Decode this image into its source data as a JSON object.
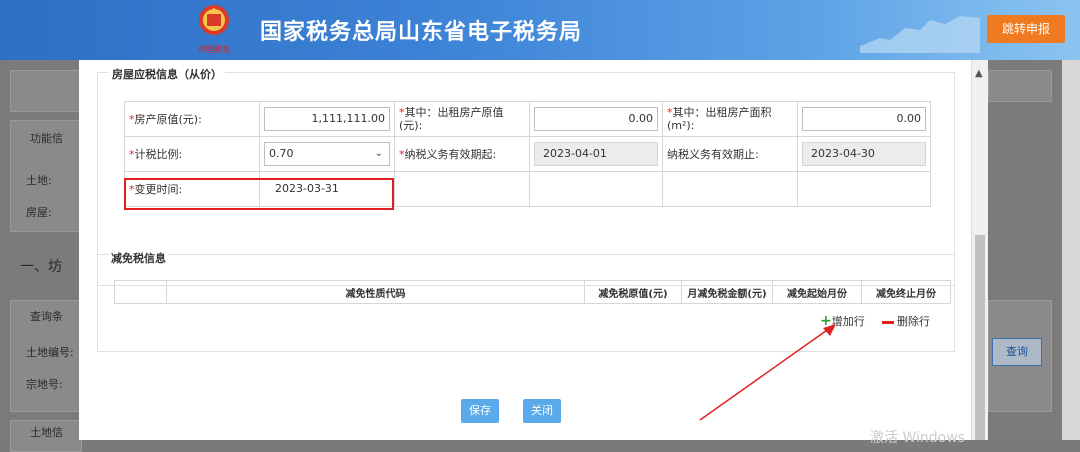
{
  "banner": {
    "title": "国家税务总局山东省电子税务局",
    "jump_button": "跳转申报",
    "emblem_text": "中国税务"
  },
  "background": {
    "labels": [
      "功能信",
      "土地:",
      "房屋:",
      "一、坊",
      "查询条",
      "土地编号:",
      "宗地号:",
      "土地信"
    ],
    "query_button": "查询"
  },
  "dialog": {
    "house_section": {
      "title": "房屋应税信息（从价）",
      "required_mark": "*",
      "fields": {
        "original_value_label": "房产原值(元):",
        "original_value": "1,111,111.00",
        "rented_original_value_label": "其中：出租房产原值(元):",
        "rented_original_value": "0.00",
        "rented_area_label": "其中：出租房产面积(m²):",
        "rented_area": "0.00",
        "tax_ratio_label": "计税比例:",
        "tax_ratio": "0.70",
        "obligation_start_label": "纳税义务有效期起:",
        "obligation_start": "2023-04-01",
        "obligation_end_label": "纳税义务有效期止:",
        "obligation_end": "2023-04-30",
        "change_time_label": "变更时间:",
        "change_time": "2023-03-31"
      }
    },
    "relief_section": {
      "title": "减免税信息",
      "columns": [
        "减免性质代码",
        "减免税原值(元)",
        "月减免税金额(元)",
        "减免起始月份",
        "减免终止月份"
      ],
      "add_row": "增加行",
      "delete_row": "删除行"
    },
    "buttons": {
      "save": "保存",
      "close": "关闭"
    }
  },
  "watermark": "激活 Windows"
}
